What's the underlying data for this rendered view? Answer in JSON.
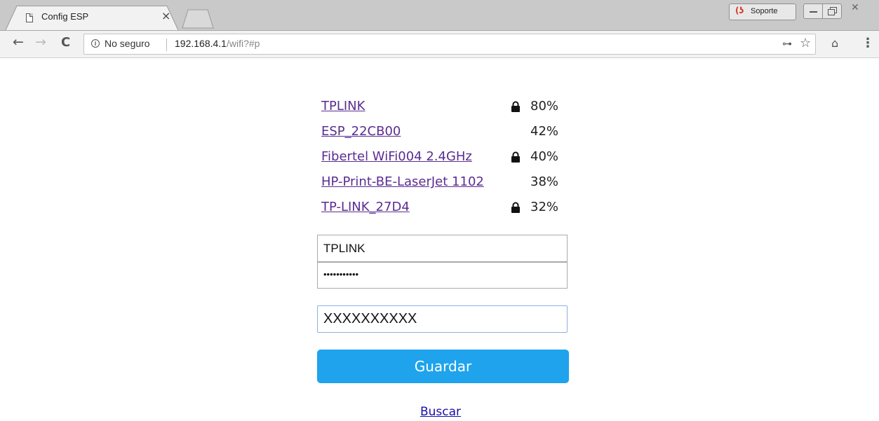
{
  "browser": {
    "tab_title": "Config ESP",
    "tab_close": "×",
    "profile_label": "Soporte",
    "window_close": "✕",
    "security_label": "No seguro",
    "url_host": "192.168.4.1",
    "url_path": "/wifi?#p"
  },
  "networks": [
    {
      "ssid": "TPLINK",
      "locked": true,
      "signal": "80%"
    },
    {
      "ssid": "ESP_22CB00",
      "locked": false,
      "signal": "42%"
    },
    {
      "ssid": "Fibertel WiFi004 2.4GHz",
      "locked": true,
      "signal": "40%"
    },
    {
      "ssid": "HP-Print-BE-LaserJet 1102",
      "locked": false,
      "signal": "38%"
    },
    {
      "ssid": "TP-LINK_27D4",
      "locked": true,
      "signal": "32%"
    }
  ],
  "form": {
    "ssid_value": "TPLINK",
    "password_value": "•••••••••••",
    "extra_value": "XXXXXXXXXX",
    "save_label": "Guardar",
    "scan_label": "Buscar"
  },
  "colors": {
    "button": "#1fa3ec",
    "visited_link": "#5b2d91",
    "link": "#1a0dab"
  }
}
